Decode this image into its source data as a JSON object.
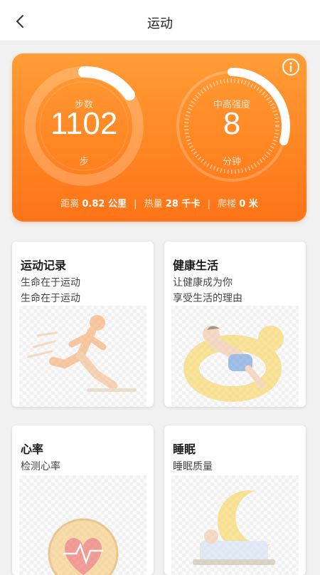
{
  "header": {
    "title": "运动"
  },
  "summary": {
    "steps": {
      "label": "步数",
      "value": "1102",
      "unit": "步"
    },
    "intensity": {
      "label": "中高强度",
      "value": "8",
      "unit": "分钟"
    },
    "stats": {
      "distance_label": "距离",
      "distance_value": "0.82 公里",
      "calories_label": "热量",
      "calories_value": "28 千卡",
      "floors_label": "爬楼",
      "floors_value": "0 米",
      "separator": "|"
    }
  },
  "cards": [
    {
      "title": "运动记录",
      "sub1": "生命在于运动",
      "sub2": "生命在于运动"
    },
    {
      "title": "健康生活",
      "sub1": "让健康成为你",
      "sub2": "享受生活的理由"
    },
    {
      "title": "心率",
      "sub1": "检测心率",
      "sub2": ""
    },
    {
      "title": "睡眠",
      "sub1": "睡眠质量",
      "sub2": ""
    }
  ],
  "icons": {
    "back": "chevron-left-icon",
    "info": "info-icon"
  },
  "colors": {
    "accent": "#ff8a26",
    "accent_dark": "#fe7418",
    "ring_track": "#ffb36b",
    "background": "#f1f1f1"
  }
}
